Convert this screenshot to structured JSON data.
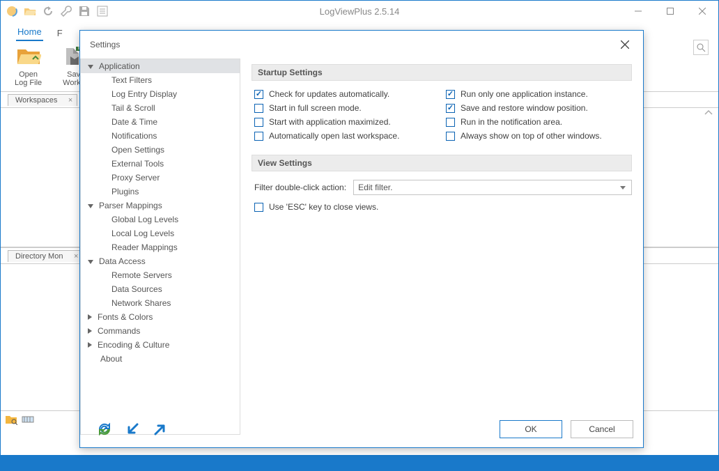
{
  "app": {
    "title": "LogViewPlus 2.5.14"
  },
  "ribbon": {
    "tabs": {
      "home": "Home",
      "file_partial": "F"
    },
    "open_log_l1": "Open",
    "open_log_l2": "Log File",
    "save_workspace_l1": "Save",
    "save_workspace_l2": "Worksp"
  },
  "panels": {
    "workspaces_tab": "Workspaces",
    "directory_tab": "Directory Mon"
  },
  "dialog": {
    "title": "Settings",
    "nav": {
      "application": "Application",
      "text_filters": "Text Filters",
      "log_entry_display": "Log Entry Display",
      "tail_scroll": "Tail & Scroll",
      "date_time": "Date & Time",
      "notifications": "Notifications",
      "open_settings": "Open Settings",
      "external_tools": "External Tools",
      "proxy_server": "Proxy Server",
      "plugins": "Plugins",
      "parser_mappings": "Parser Mappings",
      "global_log_levels": "Global Log Levels",
      "local_log_levels": "Local Log Levels",
      "reader_mappings": "Reader Mappings",
      "data_access": "Data Access",
      "remote_servers": "Remote Servers",
      "data_sources": "Data Sources",
      "network_shares": "Network Shares",
      "fonts_colors": "Fonts & Colors",
      "commands": "Commands",
      "encoding_culture": "Encoding & Culture",
      "about": "About"
    },
    "startup": {
      "header": "Startup Settings",
      "check_updates": "Check for updates automatically.",
      "run_one_instance": "Run only one application instance.",
      "start_fullscreen": "Start in full screen mode.",
      "save_restore_pos": "Save and restore window position.",
      "start_maximized": "Start with application maximized.",
      "run_notification": "Run in the notification area.",
      "auto_open_last": "Automatically open last workspace.",
      "always_on_top": "Always show on top of other windows."
    },
    "view": {
      "header": "View Settings",
      "filter_dbl_label": "Filter double-click action:",
      "filter_dbl_value": "Edit filter.",
      "use_esc": "Use 'ESC' key to close views."
    },
    "buttons": {
      "ok": "OK",
      "cancel": "Cancel"
    }
  }
}
